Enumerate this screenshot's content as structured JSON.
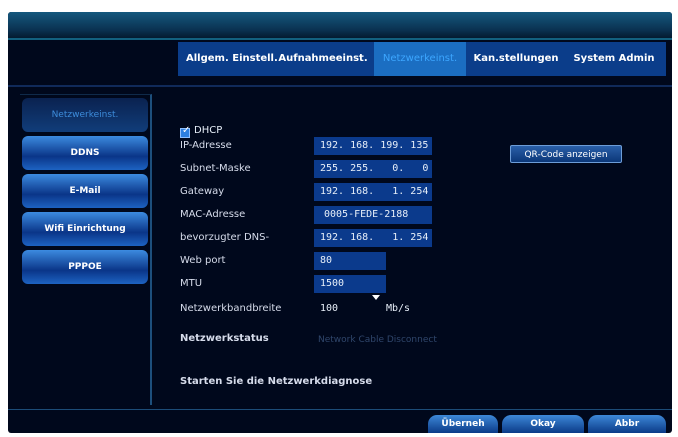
{
  "tabs": [
    {
      "label": "Allgem. Einstell.",
      "active": false
    },
    {
      "label": "Aufnahmeeinst.",
      "active": false
    },
    {
      "label": "Netzwerkeinst.",
      "active": true
    },
    {
      "label": "Kan.stellungen",
      "active": false
    },
    {
      "label": "System Admin",
      "active": false
    }
  ],
  "sidebar": {
    "items": [
      {
        "label": "Netzwerkeinst.",
        "active": true
      },
      {
        "label": "DDNS",
        "active": false
      },
      {
        "label": "E-Mail",
        "active": false
      },
      {
        "label": "Wifi Einrichtung",
        "active": false
      },
      {
        "label": "PPPOE",
        "active": false
      }
    ]
  },
  "form": {
    "dhcp_label": "DHCP",
    "dhcp_checked": true,
    "ip_label": "IP-Adresse",
    "ip_value": "192. 168. 199. 135",
    "subnet_label": "Subnet-Maske",
    "subnet_value": "255. 255.   0.   0",
    "gateway_label": "Gateway",
    "gateway_value": "192. 168.   1. 254",
    "mac_label": "MAC-Adresse",
    "mac_value": "0005-FEDE-2188",
    "dns_label": "bevorzugter DNS-",
    "dns_value": "192. 168.   1. 254",
    "webport_label": "Web port",
    "webport_value": "80",
    "mtu_label": "MTU",
    "mtu_value": "1500",
    "bandwidth_label": "Netzwerkbandbreite",
    "bandwidth_value": "100",
    "bandwidth_unit": "Mb/s",
    "status_label": "Netzwerkstatus",
    "status_value": "Network Cable Disconnect",
    "diagnose_label": "Starten Sie die Netzwerkdiagnose"
  },
  "qr_button_label": "QR-Code anzeigen",
  "buttons": {
    "apply": "Überneh",
    "ok": "Okay",
    "cancel": "Abbr"
  },
  "colors": {
    "background": "#00081c",
    "tab_bar": "#0b3d8a",
    "active_tab": "#1b6ec2",
    "field": "#0b3a8c",
    "button": "#1d63c2"
  }
}
